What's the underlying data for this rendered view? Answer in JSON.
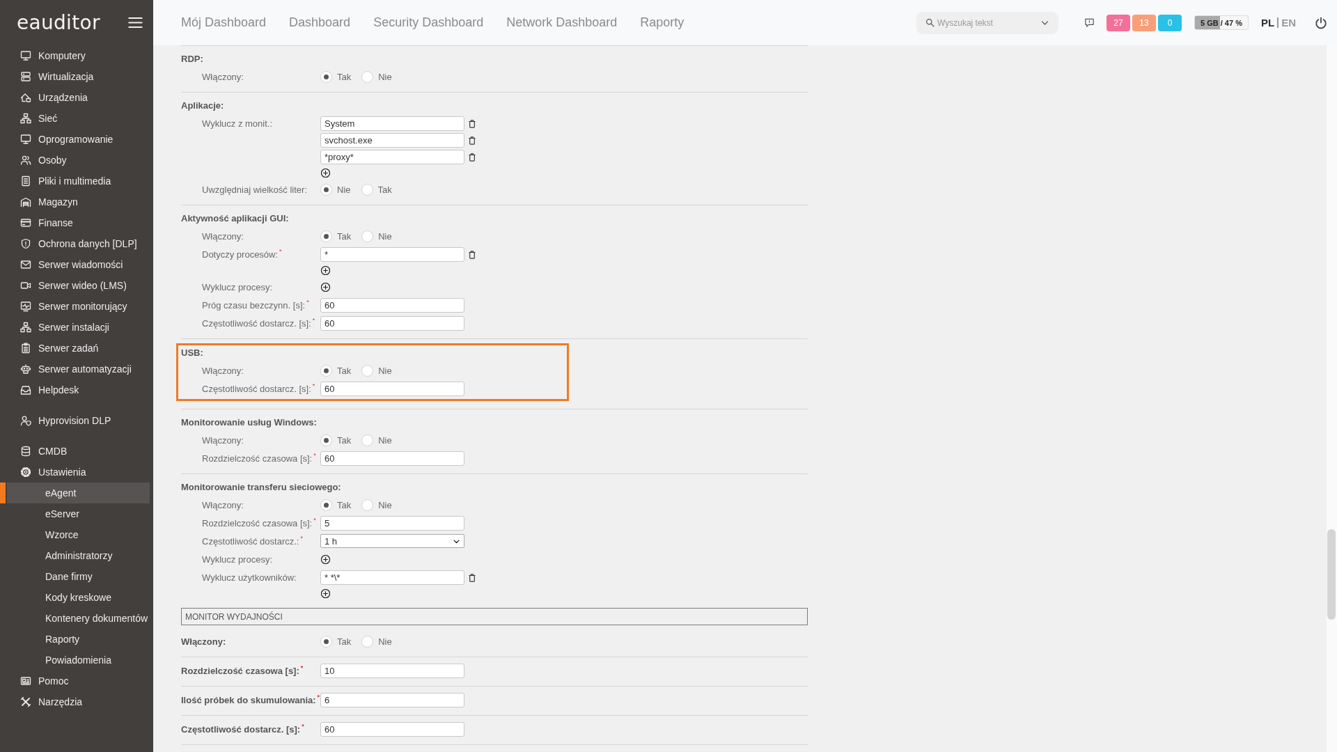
{
  "sidebar": {
    "logo": "eauditor",
    "sections": [
      {
        "items": [
          {
            "label": "Komputery",
            "selected": false
          },
          {
            "label": "Wirtualizacja",
            "selected": false
          },
          {
            "label": "Urządzenia",
            "selected": false
          },
          {
            "label": "Sieć",
            "selected": false
          },
          {
            "label": "Oprogramowanie",
            "selected": false
          },
          {
            "label": "Osoby",
            "selected": false
          },
          {
            "label": "Pliki i multimedia",
            "selected": false
          },
          {
            "label": "Magazyn",
            "selected": false
          },
          {
            "label": "Finanse",
            "selected": false
          },
          {
            "label": "Ochrona danych [DLP]",
            "selected": false
          },
          {
            "label": "Serwer wiadomości",
            "selected": false
          },
          {
            "label": "Serwer wideo (LMS)",
            "selected": false
          },
          {
            "label": "Serwer monitorujący",
            "selected": false
          },
          {
            "label": "Serwer instalacji",
            "selected": false
          },
          {
            "label": "Serwer zadań",
            "selected": false
          },
          {
            "label": "Serwer automatyzacji",
            "selected": false
          },
          {
            "label": "Helpdesk",
            "selected": false
          }
        ]
      },
      {
        "items": [
          {
            "label": "Hyprovision DLP",
            "selected": false
          }
        ]
      },
      {
        "items": [
          {
            "label": "CMDB",
            "selected": false
          },
          {
            "label": "Ustawienia",
            "selected": false,
            "expanded": true,
            "children": [
              {
                "label": "eAgent",
                "selected": true
              },
              {
                "label": "eServer",
                "selected": false
              },
              {
                "label": "Wzorce",
                "selected": false
              },
              {
                "label": "Administratorzy",
                "selected": false
              },
              {
                "label": "Dane firmy",
                "selected": false
              },
              {
                "label": "Kody kreskowe",
                "selected": false
              },
              {
                "label": "Kontenery dokumentów",
                "selected": false
              },
              {
                "label": "Raporty",
                "selected": false
              },
              {
                "label": "Powiadomienia",
                "selected": false
              }
            ]
          },
          {
            "label": "Pomoc",
            "selected": false
          },
          {
            "label": "Narzędzia",
            "selected": false
          }
        ]
      }
    ]
  },
  "header": {
    "nav": [
      {
        "label": "Mój Dashboard",
        "selected": false
      },
      {
        "label": "Dashboard",
        "selected": false
      },
      {
        "label": "Security Dashboard",
        "selected": false
      },
      {
        "label": "Network Dashboard",
        "selected": false
      },
      {
        "label": "Raporty",
        "selected": false
      }
    ],
    "search": {
      "placeholder": "Wyszukaj tekst"
    },
    "badges": [
      {
        "label": "27",
        "color": "#f2709a"
      },
      {
        "label": "13",
        "color": "#f89e79"
      },
      {
        "label": "0",
        "color": "#29c1e6"
      }
    ],
    "storage": {
      "text": "5 GB / 47 %",
      "level": 0.47
    },
    "languages": [
      {
        "label": "PL",
        "selected": true
      },
      {
        "label": "EN",
        "selected": false
      }
    ]
  },
  "form": {
    "groups": [
      {
        "title": "RDP:",
        "highlighted": false,
        "rows": [
          {
            "kind": "radio",
            "label": "Włączony:",
            "options": [
              {
                "label": "Tak",
                "selected": true
              },
              {
                "label": "Nie",
                "selected": false
              }
            ]
          }
        ]
      },
      {
        "title": "Aplikacje:",
        "highlighted": false,
        "rows": [
          {
            "kind": "list",
            "label": "Wyklucz z monit.:",
            "values": [
              "System",
              "svchost.exe",
              "*proxy*"
            ]
          },
          {
            "kind": "radio",
            "label": "Uwzględniaj wielkość liter:",
            "options": [
              {
                "label": "Nie",
                "selected": true
              },
              {
                "label": "Tak",
                "selected": false
              }
            ]
          }
        ]
      },
      {
        "title": "Aktywność aplikacji GUI:",
        "highlighted": false,
        "rows": [
          {
            "kind": "radio",
            "label": "Włączony:",
            "options": [
              {
                "label": "Tak",
                "selected": true
              },
              {
                "label": "Nie",
                "selected": false
              }
            ]
          },
          {
            "kind": "list",
            "label": "Dotyczy procesów:$^{*}$",
            "values": [
              "*"
            ]
          },
          {
            "kind": "list",
            "label": "Wyklucz procesy:"
          },
          {
            "kind": "text",
            "label": "Próg czasu bezczynn. [s]:$^{*}$",
            "value": "60"
          },
          {
            "kind": "text",
            "label": "Częstotliwość dostarcz. [s]:$^{*}$",
            "value": "60"
          }
        ]
      },
      {
        "title": "USB:",
        "highlighted": true,
        "rows": [
          {
            "kind": "radio",
            "label": "Włączony:",
            "options": [
              {
                "label": "Tak",
                "selected": true
              },
              {
                "label": "Nie",
                "selected": false
              }
            ]
          },
          {
            "kind": "text",
            "label": "Częstotliwość dostarcz. [s]:$^{*}$",
            "value": "60"
          }
        ]
      },
      {
        "title": "Monitorowanie usług Windows:",
        "highlighted": false,
        "rows": [
          {
            "kind": "radio",
            "label": "Włączony:",
            "options": [
              {
                "label": "Tak",
                "selected": true
              },
              {
                "label": "Nie",
                "selected": false
              }
            ]
          },
          {
            "kind": "text",
            "label": "Rozdzielczość czasowa [s]:$^{*}$",
            "value": "60"
          }
        ]
      },
      {
        "title": "Monitorowanie transferu sieciowego:",
        "highlighted": false,
        "rows": [
          {
            "kind": "radio",
            "label": "Włączony:",
            "options": [
              {
                "label": "Tak",
                "selected": true
              },
              {
                "label": "Nie",
                "selected": false
              }
            ]
          },
          {
            "kind": "text",
            "label": "Rozdzielczość czasowa [s]:$^{*}$",
            "value": "5"
          },
          {
            "kind": "select",
            "label": "Częstotliwość dostarcz.:$^{*}$",
            "value": "1 h"
          },
          {
            "kind": "list",
            "label": "Wyklucz procesy:"
          },
          {
            "kind": "list",
            "label": "Wyklucz użytkowników:",
            "values": [
              "* *\\*"
            ]
          }
        ]
      }
    ],
    "panel": {
      "title": "MONITOR WYDAJNOŚCI",
      "rows": [
        {
          "kind": "radio",
          "label": "Włączony:",
          "options": [
            {
              "label": "Tak",
              "selected": true
            },
            {
              "label": "Nie",
              "selected": false
            }
          ]
        },
        {
          "kind": "text",
          "label": "Rozdzielczość czasowa [s]:$^{*}$",
          "value": "10"
        },
        {
          "kind": "text",
          "label": "Ilość próbek do skumulowania:$^{*}$",
          "value": "6"
        },
        {
          "kind": "text",
          "label": "Częstotliwość dostarcz. [s]:$^{*}$",
          "value": "60"
        }
      ]
    }
  }
}
